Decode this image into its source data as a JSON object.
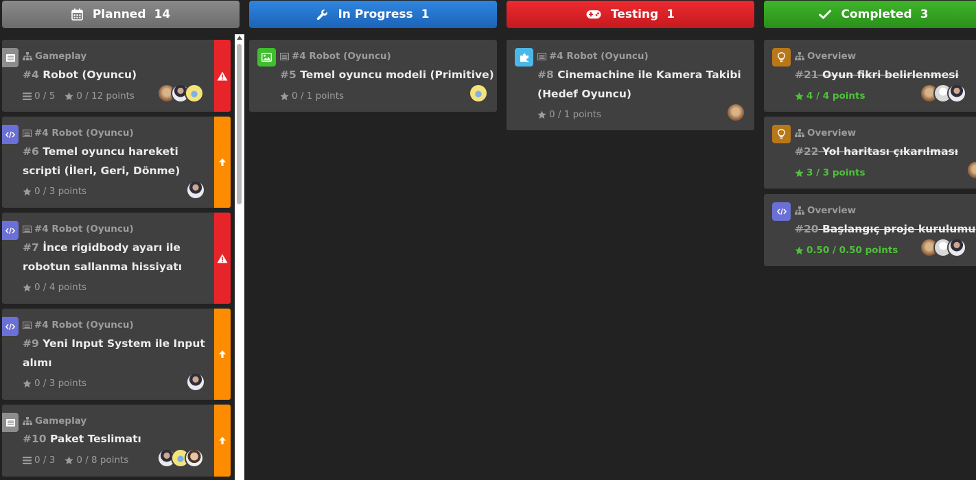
{
  "columns": {
    "planned": {
      "label": "Planned",
      "count": "14",
      "icon": "calendar-icon",
      "color": "#7a7a7a"
    },
    "in_progress": {
      "label": "In Progress",
      "count": "1",
      "icon": "wrench-icon",
      "color": "#2475cd"
    },
    "testing": {
      "label": "Testing",
      "count": "1",
      "icon": "gamepad-icon",
      "color": "#d91f25"
    },
    "completed": {
      "label": "Completed",
      "count": "3",
      "icon": "check-icon",
      "color": "#35a322"
    }
  },
  "planned_cards": [
    {
      "parent": "Gameplay",
      "parent_icon": "sitemap-icon",
      "number": "#4",
      "title": "Robot (Oyuncu)",
      "tasks": "0 / 5",
      "points": "0 / 12 points",
      "priority": "critical",
      "type_icon": "list-icon"
    },
    {
      "parent": "#4 Robot (Oyuncu)",
      "parent_icon": "list-icon",
      "number": "#6",
      "title_line1": "Temel oyuncu hareketi",
      "title_line2": "scripti (İleri, Geri, Dönme)",
      "points": "0 / 3 points",
      "priority": "high",
      "type_icon": "code-icon"
    },
    {
      "parent": "#4 Robot (Oyuncu)",
      "parent_icon": "list-icon",
      "number": "#7",
      "title_line1": "İnce rigidbody ayarı ile",
      "title_line2": "robotun sallanma hissiyatı",
      "points": "0 / 4 points",
      "priority": "critical",
      "type_icon": "code-icon"
    },
    {
      "parent": "#4 Robot (Oyuncu)",
      "parent_icon": "list-icon",
      "number": "#9",
      "title_line1": "Yeni Input System ile Input",
      "title_line2": "alımı",
      "points": "0 / 3 points",
      "priority": "high",
      "type_icon": "code-icon"
    },
    {
      "parent": "Gameplay",
      "parent_icon": "sitemap-icon",
      "number": "#10",
      "title": "Paket Teslimatı",
      "tasks": "0 / 3",
      "points": "0 / 8 points",
      "priority": "high",
      "type_icon": "list-icon"
    }
  ],
  "in_progress_cards": [
    {
      "parent": "#4 Robot (Oyuncu)",
      "number": "#5",
      "title": "Temel oyuncu modeli (Primitive)",
      "points": "0 / 1 points",
      "type_icon": "image-icon",
      "type_color": "#3fbf2f"
    }
  ],
  "testing_cards": [
    {
      "parent": "#4 Robot (Oyuncu)",
      "number": "#8",
      "title_line1": "Cinemachine ile Kamera Takibi",
      "title_line2": "(Hedef Oyuncu)",
      "points": "0 / 1 points",
      "type_icon": "puzzle-icon",
      "type_color": "#4ab8e8"
    }
  ],
  "completed_cards": [
    {
      "parent": "Overview",
      "number": "#21",
      "title": "Oyun fikri belirlenmesi",
      "points": "4 / 4 points",
      "type_icon": "lightbulb-icon",
      "type_color": "#b8781a"
    },
    {
      "parent": "Overview",
      "number": "#22",
      "title": "Yol haritası çıkarılması",
      "points": "3 / 3 points",
      "type_icon": "lightbulb-icon",
      "type_color": "#b8781a"
    },
    {
      "parent": "Overview",
      "number": "#20",
      "title": "Başlangıç proje kurulumu",
      "points": "0.50 / 0.50 points",
      "type_icon": "code-icon",
      "type_color": "#6b70d6"
    }
  ]
}
